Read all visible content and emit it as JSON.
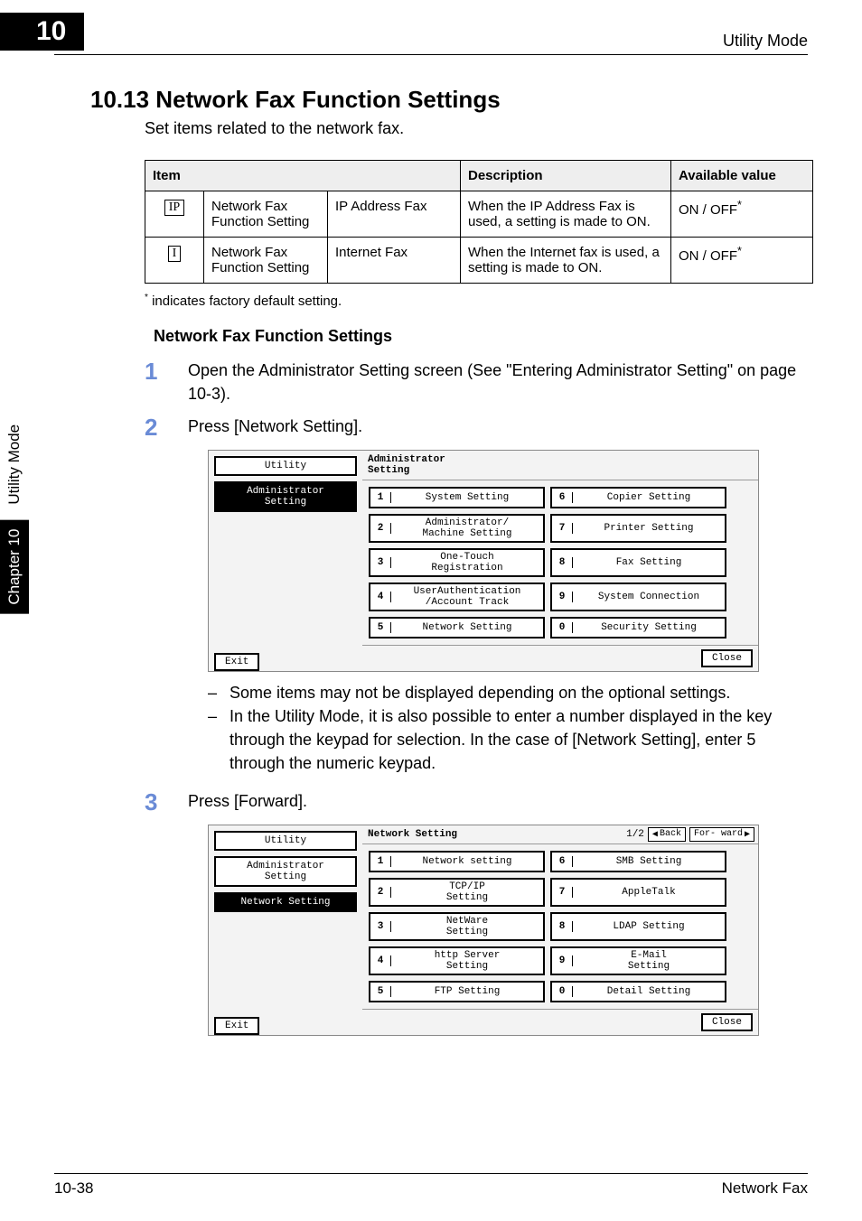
{
  "header": {
    "chapter_number": "10",
    "right_label": "Utility Mode"
  },
  "sidetab": {
    "chapter_label": "Chapter 10",
    "section_label": "Utility Mode"
  },
  "section": {
    "number_title": "10.13  Network Fax Function Settings",
    "intro": "Set items related to the network fax."
  },
  "table": {
    "headers": {
      "item": "Item",
      "description": "Description",
      "available": "Available value"
    },
    "rows": [
      {
        "icon": "IP",
        "col1": "Network Fax Function Setting",
        "col2": "IP Address Fax",
        "desc": "When the IP Address Fax is used, a setting is made to ON.",
        "value": "ON / OFF",
        "has_ast": true
      },
      {
        "icon": "I",
        "col1": "Network Fax Function Setting",
        "col2": "Internet Fax",
        "desc": "When the Internet fax is used, a setting is made to ON.",
        "value": "ON / OFF",
        "has_ast": true
      }
    ]
  },
  "footnote": {
    "ast": "*",
    "text": " indicates factory default setting."
  },
  "subheading": "Network Fax Function Settings",
  "steps": [
    {
      "num": "1",
      "text": "Open the Administrator Setting screen (See \"Entering Administrator Setting\" on page 10-3)."
    },
    {
      "num": "2",
      "text": "Press [Network Setting]."
    },
    {
      "num": "3",
      "text": "Press [Forward]."
    }
  ],
  "notes": [
    "Some items may not be displayed depending on the optional settings.",
    "In the Utility Mode, it is also possible to enter a number displayed in the key through the keypad for selection. In the case of [Network Setting], enter 5 through the numeric keypad."
  ],
  "panel1": {
    "tabs": [
      {
        "label": "Utility",
        "sel": false
      },
      {
        "label": "Administrator\nSetting",
        "sel": true
      }
    ],
    "title": "Administrator\nSetting",
    "buttons": [
      {
        "n": "1",
        "label": "System Setting"
      },
      {
        "n": "6",
        "label": "Copier Setting"
      },
      {
        "n": "2",
        "label": "Administrator/\nMachine Setting"
      },
      {
        "n": "7",
        "label": "Printer Setting"
      },
      {
        "n": "3",
        "label": "One-Touch\nRegistration"
      },
      {
        "n": "8",
        "label": "Fax Setting"
      },
      {
        "n": "4",
        "label": "UserAuthentication\n/Account Track"
      },
      {
        "n": "9",
        "label": "System Connection"
      },
      {
        "n": "5",
        "label": "Network Setting"
      },
      {
        "n": "0",
        "label": "Security Setting"
      }
    ],
    "exit": "Exit",
    "close": "Close"
  },
  "panel2": {
    "tabs": [
      {
        "label": "Utility",
        "sel": false
      },
      {
        "label": "Administrator\nSetting",
        "sel": false
      },
      {
        "label": "Network Setting",
        "sel": true
      }
    ],
    "title": "Network Setting",
    "page": "1/2",
    "back": "Back",
    "forward": "For-\nward",
    "buttons": [
      {
        "n": "1",
        "label": "Network setting"
      },
      {
        "n": "6",
        "label": "SMB Setting"
      },
      {
        "n": "2",
        "label": "TCP/IP\nSetting"
      },
      {
        "n": "7",
        "label": "AppleTalk"
      },
      {
        "n": "3",
        "label": "NetWare\nSetting"
      },
      {
        "n": "8",
        "label": "LDAP Setting"
      },
      {
        "n": "4",
        "label": "http Server\nSetting"
      },
      {
        "n": "9",
        "label": "E-Mail\nSetting"
      },
      {
        "n": "5",
        "label": "FTP Setting"
      },
      {
        "n": "0",
        "label": "Detail Setting"
      }
    ],
    "exit": "Exit",
    "close": "Close"
  },
  "footer": {
    "left": "10-38",
    "right": "Network Fax"
  }
}
